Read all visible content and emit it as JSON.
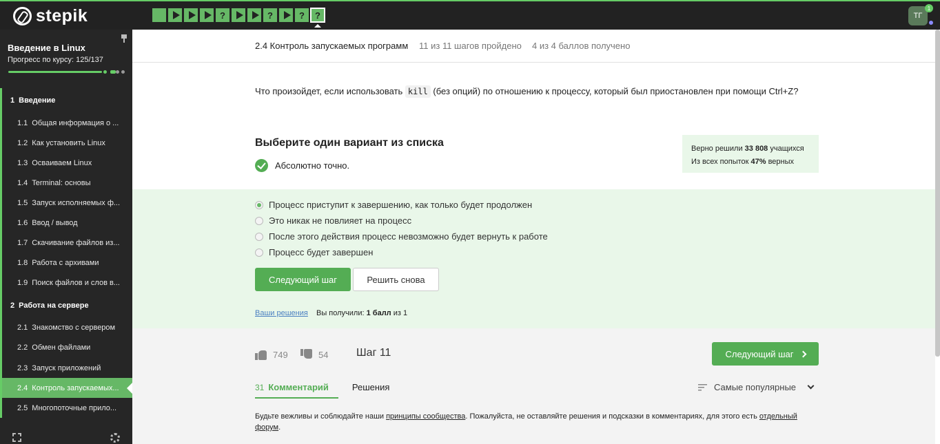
{
  "topbar": {
    "logo_text": "stepik",
    "steps": [
      "passed",
      "video",
      "video",
      "video",
      "quiz",
      "video",
      "video",
      "quiz",
      "video",
      "quiz",
      "quiz"
    ],
    "step_quiz_glyph": "?",
    "avatar_initials": "ТГ",
    "notification_count": "1",
    "accent_color": "#66b866"
  },
  "sidebar": {
    "course_title": "Введение в Linux",
    "progress_text": "Прогресс по курсу:  125/137",
    "progress_value": 125,
    "progress_max": 137,
    "sections": [
      {
        "num": "1",
        "title": "Введение",
        "items": [
          {
            "num": "1.1",
            "label": "Общая информация о ..."
          },
          {
            "num": "1.2",
            "label": "Как установить Linux"
          },
          {
            "num": "1.3",
            "label": "Осваиваем Linux"
          },
          {
            "num": "1.4",
            "label": "Terminal: основы"
          },
          {
            "num": "1.5",
            "label": "Запуск исполняемых ф..."
          },
          {
            "num": "1.6",
            "label": "Ввод / вывод"
          },
          {
            "num": "1.7",
            "label": "Скачивание файлов из..."
          },
          {
            "num": "1.8",
            "label": "Работа с архивами"
          },
          {
            "num": "1.9",
            "label": "Поиск файлов и слов в..."
          }
        ]
      },
      {
        "num": "2",
        "title": "Работа на сервере",
        "items": [
          {
            "num": "2.1",
            "label": "Знакомство с сервером"
          },
          {
            "num": "2.2",
            "label": "Обмен файлами"
          },
          {
            "num": "2.3",
            "label": "Запуск приложений"
          },
          {
            "num": "2.4",
            "label": "Контроль запускаемых..."
          },
          {
            "num": "2.5",
            "label": "Многопоточные прило..."
          }
        ]
      }
    ]
  },
  "lesson": {
    "title": "2.4 Контроль запускаемых программ",
    "steps_done": "11 из 11 шагов пройдено",
    "score": "4 из 4 баллов  получено"
  },
  "question": {
    "before": "Что произойдет, если использовать ",
    "code": "kill",
    "after": " (без опций) по отношению к процессу, который был приостановлен при помощи Ctrl+Z?"
  },
  "quiz": {
    "choose_title": "Выберите один вариант из списка",
    "feedback": "Абсолютно точно.",
    "stats_line1_prefix": "Верно решили ",
    "stats_line1_bold": "33 808",
    "stats_line1_suffix": " учащихся",
    "stats_line2_prefix": "Из всех попыток ",
    "stats_line2_bold": "47%",
    "stats_line2_suffix": " верных",
    "options": [
      {
        "label": "Процесс приступит к завершению, как только будет продолжен",
        "selected": true
      },
      {
        "label": "Это никак не повлияет на процесс",
        "selected": false
      },
      {
        "label": "После этого действия процесс невозможно будет вернуть к работе",
        "selected": false
      },
      {
        "label": "Процесс будет завершен",
        "selected": false
      }
    ],
    "next_button": "Следующий шаг",
    "retry_button": "Решить снова",
    "solutions_link": "Ваши решения",
    "score_prefix": "Вы получили: ",
    "score_bold": "1 балл",
    "score_suffix": " из 1"
  },
  "footer": {
    "likes": "749",
    "dislikes": "54",
    "step_label": "Шаг 11",
    "next_button": "Следующий шаг",
    "tabs": [
      {
        "count": "31",
        "label": "Комментарий"
      },
      {
        "count": "",
        "label": "Решения"
      }
    ],
    "sort_label": "Самые популярные",
    "policy_part1": "Будьте вежливы и соблюдайте наши ",
    "policy_link1": "принципы сообщества",
    "policy_part2": ". Пожалуйста, не оставляйте решения и подсказки в комментариях, для этого есть ",
    "policy_link2": "отдельный форум",
    "policy_part3": "."
  }
}
